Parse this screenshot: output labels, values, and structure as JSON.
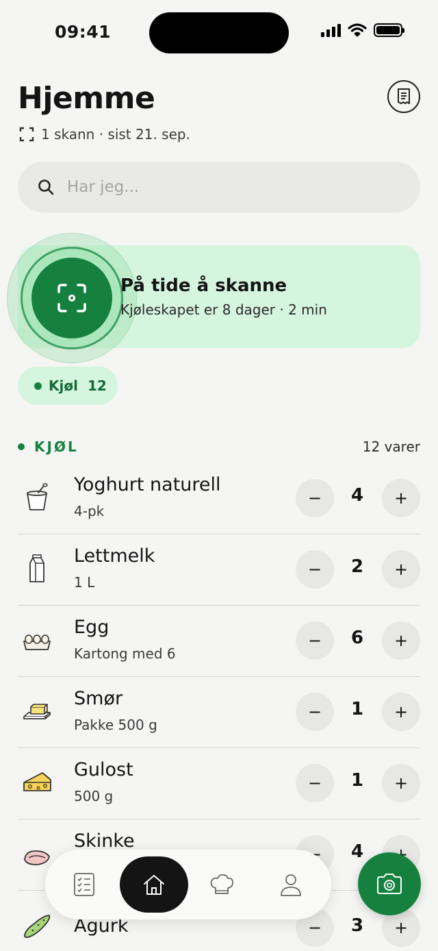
{
  "status_bar": {
    "time": "09:41"
  },
  "header": {
    "title": "Hjemme",
    "scan_meta": "1 skann · sist 21. sep."
  },
  "search": {
    "placeholder": "Har jeg..."
  },
  "scan_card": {
    "title": "På tide å skanne",
    "subtitle": "Kjøleskapet er 8 dager · 2 min"
  },
  "filter_chip": {
    "label": "Kjøl",
    "count": "12"
  },
  "section": {
    "label": "KJØL",
    "count": "12 varer"
  },
  "items": [
    {
      "name": "Yoghurt naturell",
      "sub": "4-pk",
      "qty": "4",
      "icon": "yogurt-icon"
    },
    {
      "name": "Lettmelk",
      "sub": "1 L",
      "qty": "2",
      "icon": "milk-carton-icon"
    },
    {
      "name": "Egg",
      "sub": "Kartong med 6",
      "qty": "6",
      "icon": "egg-carton-icon"
    },
    {
      "name": "Smør",
      "sub": "Pakke 500 g",
      "qty": "1",
      "icon": "butter-icon"
    },
    {
      "name": "Gulost",
      "sub": "500 g",
      "qty": "1",
      "icon": "cheese-icon"
    },
    {
      "name": "Skinke",
      "sub": "",
      "qty": "4",
      "icon": "ham-icon"
    },
    {
      "name": "Agurk",
      "sub": "",
      "qty": "3",
      "icon": "cucumber-icon"
    }
  ],
  "stepper": {
    "minus": "−",
    "plus": "+"
  },
  "tabbar": {
    "tabs": [
      "list-icon",
      "home-icon",
      "chef-hat-icon",
      "profile-icon"
    ],
    "active": "home-icon"
  },
  "fab": {
    "icon": "camera-icon"
  },
  "colors": {
    "accent": "#16813f",
    "accent_light": "#d6f5df",
    "dark": "#141414"
  }
}
